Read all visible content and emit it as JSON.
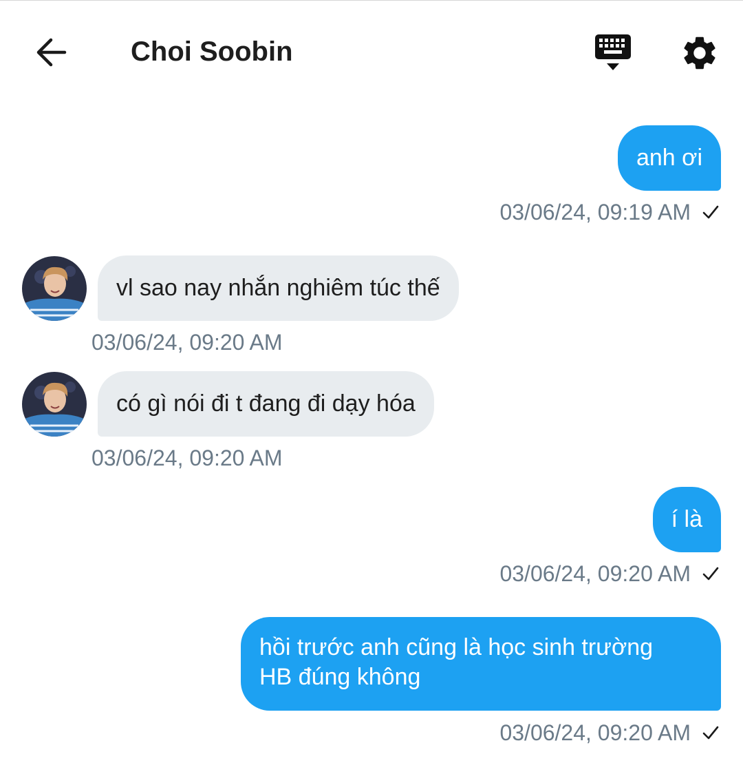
{
  "header": {
    "title": "Choi Soobin",
    "back_icon": "arrow-left-icon",
    "keyboard_icon": "keyboard-icon",
    "settings_icon": "gear-icon"
  },
  "colors": {
    "outgoing_bubble": "#1da1f2",
    "incoming_bubble": "#e8ecef",
    "timestamp": "#6a7a88"
  },
  "messages": [
    {
      "direction": "out",
      "text": "anh ơi",
      "timestamp": "03/06/24, 09:19 AM",
      "status_icon": "check-icon"
    },
    {
      "direction": "in",
      "text": "vl sao nay nhắn nghiêm túc thế",
      "timestamp": "03/06/24, 09:20 AM",
      "avatar_icon": "avatar"
    },
    {
      "direction": "in",
      "text": "có gì nói đi t đang đi dạy hóa",
      "timestamp": "03/06/24, 09:20 AM",
      "avatar_icon": "avatar"
    },
    {
      "direction": "out",
      "text": "í là",
      "timestamp": "03/06/24, 09:20 AM",
      "status_icon": "check-icon"
    },
    {
      "direction": "out",
      "text_lines": [
        "hồi trước anh cũng là học sinh trường",
        "HB đúng không"
      ],
      "timestamp": "03/06/24, 09:20 AM",
      "status_icon": "check-icon"
    }
  ]
}
